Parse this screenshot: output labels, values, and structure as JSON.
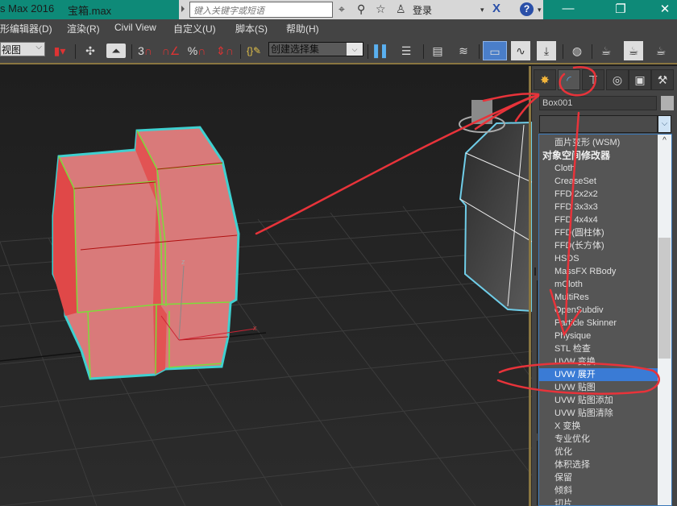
{
  "titlebar": {
    "app_title": "s Max 2016",
    "file_title": "宝箱.max",
    "search_placeholder": "键入关键字或短语",
    "login_label": "登录",
    "icons": [
      "binoculars-icon",
      "satellite-icon",
      "star-icon",
      "user-icon",
      "exchange-x-icon",
      "help-icon"
    ],
    "help_glyph": "?",
    "x_glyph": "X",
    "window_buttons": {
      "minimize": "—",
      "restore": "❐",
      "close": "✕"
    }
  },
  "menubar": {
    "items": [
      "形编辑器(D)",
      "渲染(R)",
      "Civil View",
      "自定义(U)",
      "脚本(S)",
      "帮助(H)"
    ]
  },
  "toolbar": {
    "view_combo": "视图",
    "snap_3d_label": "3",
    "percent_label": "%",
    "selection_set_placeholder": "创建选择集",
    "chevron": "⌵"
  },
  "command_panel": {
    "tabs": [
      "create",
      "modify",
      "hierarchy",
      "motion",
      "display",
      "utilities"
    ],
    "object_name": "Box001",
    "modifier_list_value": "",
    "modifier_items": [
      {
        "label": "面片变形 (WSM)",
        "type": "sub"
      },
      {
        "label": "对象空间修改器",
        "type": "header"
      },
      {
        "label": "Cloth",
        "type": "item"
      },
      {
        "label": "CreaseSet",
        "type": "item"
      },
      {
        "label": "FFD 2x2x2",
        "type": "item"
      },
      {
        "label": "FFD 3x3x3",
        "type": "item"
      },
      {
        "label": "FFD 4x4x4",
        "type": "item"
      },
      {
        "label": "FFD(圆柱体)",
        "type": "item"
      },
      {
        "label": "FFD(长方体)",
        "type": "item"
      },
      {
        "label": "HSDS",
        "type": "item"
      },
      {
        "label": "MassFX RBody",
        "type": "item"
      },
      {
        "label": "mCloth",
        "type": "item"
      },
      {
        "label": "MultiRes",
        "type": "item"
      },
      {
        "label": "OpenSubdiv",
        "type": "item"
      },
      {
        "label": "Particle Skinner",
        "type": "item"
      },
      {
        "label": "Physique",
        "type": "item"
      },
      {
        "label": "STL 检查",
        "type": "item"
      },
      {
        "label": "UVW 变换",
        "type": "item"
      },
      {
        "label": "UVW 展开",
        "type": "selected"
      },
      {
        "label": "UVW 贴图",
        "type": "item"
      },
      {
        "label": "UVW 贴图添加",
        "type": "item"
      },
      {
        "label": "UVW 贴图清除",
        "type": "item"
      },
      {
        "label": "X 变换",
        "type": "item"
      },
      {
        "label": "专业优化",
        "type": "item"
      },
      {
        "label": "优化",
        "type": "item"
      },
      {
        "label": "体积选择",
        "type": "item"
      },
      {
        "label": "保留",
        "type": "item"
      },
      {
        "label": "倾斜",
        "type": "item"
      },
      {
        "label": "切片",
        "type": "item"
      }
    ],
    "scroll_up_glyph": "^"
  },
  "viewport": {
    "axis_labels": {
      "z": "z",
      "x": "x"
    },
    "colors": {
      "object_fill": "#d97a7a",
      "object_side": "#e04848",
      "selection_outline": "#3fd0d0",
      "edge_green": "#7ddc3a",
      "annotation_red": "#e8333a",
      "grid": "#3a3a3a"
    }
  }
}
